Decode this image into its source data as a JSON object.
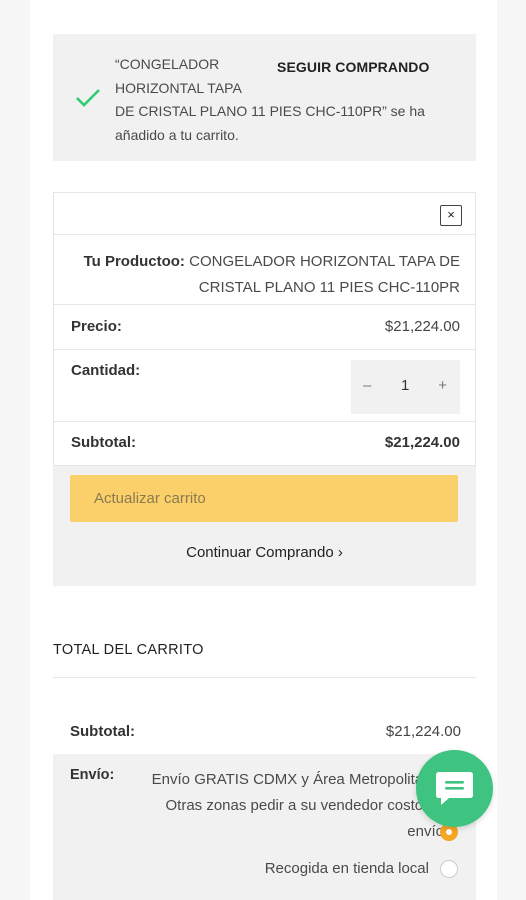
{
  "notice": {
    "message_line1": "“CONGELADOR HORIZONTAL TAPA",
    "message_line2": "DE CRISTAL PLANO 11 PIES CHC-110PR” se ha añadido a tu carrito.",
    "keep_shopping": "SEGUIR COMPRANDO",
    "icon": "check-icon"
  },
  "cart": {
    "close_symbol": "×",
    "product_label": "Tu Productoo:",
    "product_name": "CONGELADOR HORIZONTAL TAPA DE CRISTAL PLANO 11 PIES CHC-110PR",
    "price_label": "Precio:",
    "price_value": "$21,224.00",
    "qty_label": "Cantidad:",
    "qty_minus": "–",
    "qty_value": "1",
    "qty_plus": "+",
    "subtotal_label": "Subtotal:",
    "subtotal_value": "$21,224.00",
    "update_button": "Actualizar carrito",
    "continue_link": "Continuar Comprando ›"
  },
  "totals": {
    "title": "TOTAL DEL CARRITO",
    "subtotal_label": "Subtotal:",
    "subtotal_value": "$21,224.00",
    "shipping_label": "Envío:",
    "shipping_option1": "Envío GRATIS CDMX y Área Metropolitana, Otras zonas pedir a su vendedor costo de envío",
    "shipping_option2": "Recogida en tienda local"
  },
  "colors": {
    "accent_yellow": "#fbd06a",
    "radio_orange": "#f5a623",
    "chat_green": "#3fc380",
    "check_green": "#2ecc71"
  },
  "chat": {
    "icon": "chat-bubble-icon"
  }
}
